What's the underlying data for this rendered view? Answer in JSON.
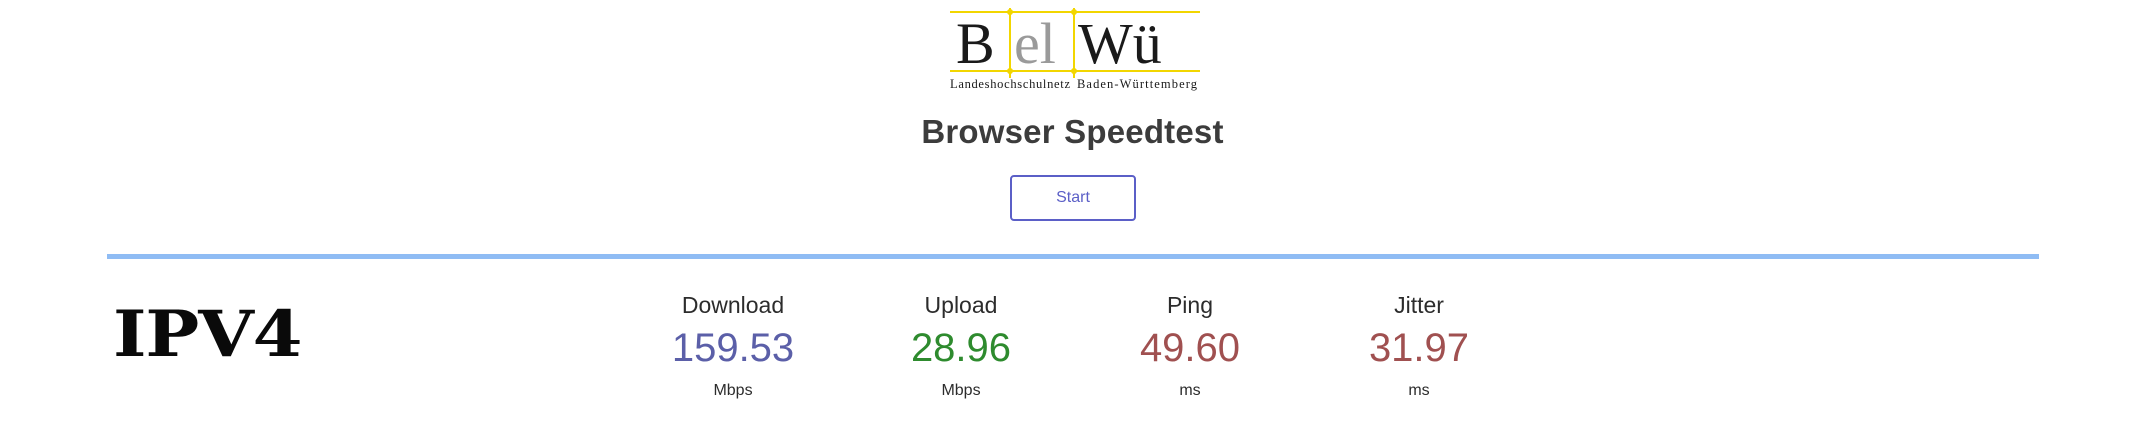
{
  "logo": {
    "letters": [
      "B",
      "el",
      "Wü"
    ],
    "subtitle_left": "Landeshochschulnetz",
    "subtitle_right": "Baden-Württemberg",
    "grid_color": "#f2d600",
    "letter_color": "#1a1a1a",
    "accent_letter_color": "#9a9a9a"
  },
  "title": "Browser Speedtest",
  "start_label": "Start",
  "divider_color": "#8fbcf4",
  "protocol": "IPV4",
  "metrics": [
    {
      "label": "Download",
      "value": "159.53",
      "unit": "Mbps",
      "color": "#5b5fa8"
    },
    {
      "label": "Upload",
      "value": "28.96",
      "unit": "Mbps",
      "color": "#2e8b2e"
    },
    {
      "label": "Ping",
      "value": "49.60",
      "unit": "ms",
      "color": "#a05050"
    },
    {
      "label": "Jitter",
      "value": "31.97",
      "unit": "ms",
      "color": "#a05050"
    }
  ]
}
